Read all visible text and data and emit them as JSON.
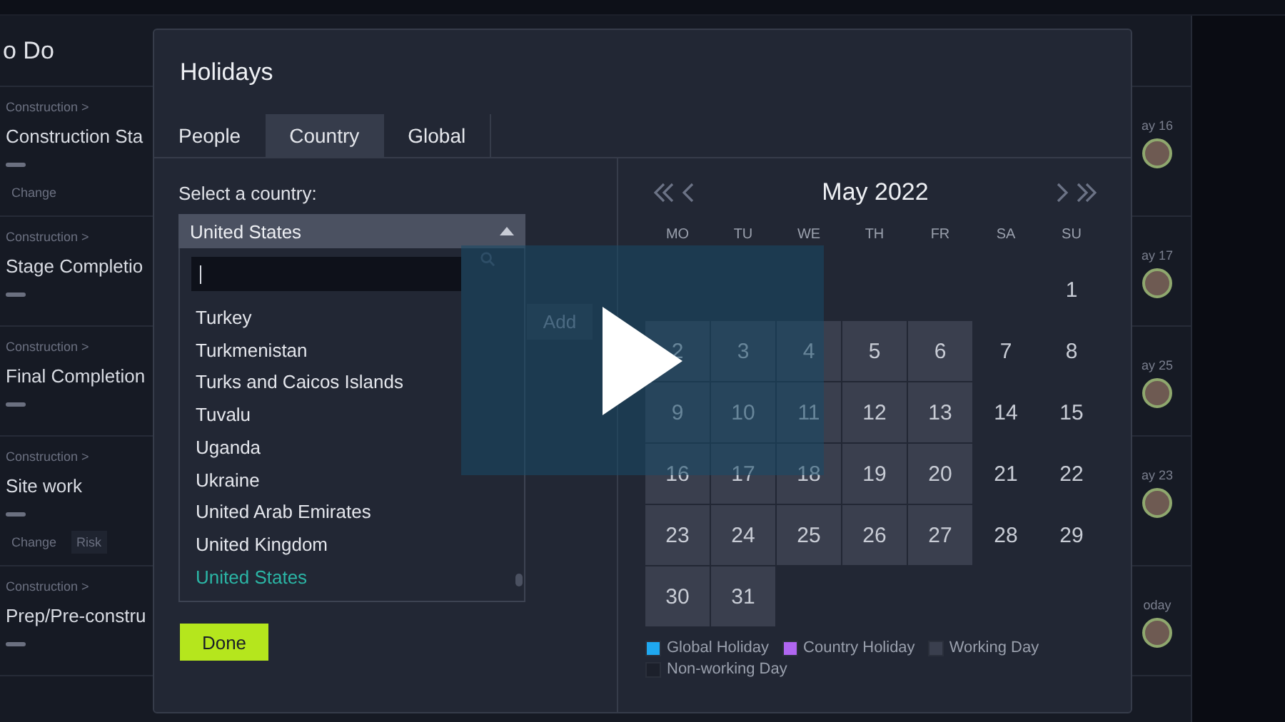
{
  "board": {
    "column_title": "o Do",
    "cards": [
      {
        "breadcrumb": "Construction >",
        "title": "Construction Sta",
        "tags": [
          {
            "label": "Change",
            "filled": false
          }
        ],
        "date": "ay 16"
      },
      {
        "breadcrumb": "Construction >",
        "title": "Stage Completio",
        "date": "ay 17"
      },
      {
        "breadcrumb": "Construction >",
        "title": "Final Completion",
        "date": "ay 25"
      },
      {
        "breadcrumb": "Construction >",
        "title": "Site work",
        "tags": [
          {
            "label": "Change",
            "filled": false
          },
          {
            "label": "Risk",
            "filled": true
          }
        ],
        "date": "ay 23"
      },
      {
        "breadcrumb": "Construction >",
        "title": "Prep/Pre-constru",
        "date": "oday"
      }
    ]
  },
  "dialog": {
    "title": "Holidays",
    "tabs": [
      {
        "label": "People",
        "selected": false
      },
      {
        "label": "Country",
        "selected": true
      },
      {
        "label": "Global",
        "selected": false
      }
    ],
    "country_label": "Select a country:",
    "country_select": {
      "value": "United States",
      "expanded": true
    },
    "countries": [
      {
        "name": "Turkey",
        "selected": false
      },
      {
        "name": "Turkmenistan",
        "selected": false
      },
      {
        "name": "Turks and Caicos Islands",
        "selected": false
      },
      {
        "name": "Tuvalu",
        "selected": false
      },
      {
        "name": "Uganda",
        "selected": false
      },
      {
        "name": "Ukraine",
        "selected": false
      },
      {
        "name": "United Arab Emirates",
        "selected": false
      },
      {
        "name": "United Kingdom",
        "selected": false
      },
      {
        "name": "United States",
        "selected": true
      }
    ],
    "add_button": "Add",
    "done_button": "Done",
    "calendar": {
      "month": "May 2022",
      "weekdays": [
        "MO",
        "TU",
        "WE",
        "TH",
        "FR",
        "SA",
        "SU"
      ],
      "days": [
        {
          "kind": "empty"
        },
        {
          "kind": "empty"
        },
        {
          "kind": "empty"
        },
        {
          "kind": "empty"
        },
        {
          "kind": "empty"
        },
        {
          "kind": "empty"
        },
        {
          "day": "1",
          "kind": "nonworking"
        },
        {
          "day": "2",
          "kind": "working"
        },
        {
          "day": "3",
          "kind": "working"
        },
        {
          "day": "4",
          "kind": "working"
        },
        {
          "day": "5",
          "kind": "working"
        },
        {
          "day": "6",
          "kind": "working"
        },
        {
          "day": "7",
          "kind": "nonworking"
        },
        {
          "day": "8",
          "kind": "nonworking"
        },
        {
          "day": "9",
          "kind": "working"
        },
        {
          "day": "10",
          "kind": "working"
        },
        {
          "day": "11",
          "kind": "working"
        },
        {
          "day": "12",
          "kind": "working"
        },
        {
          "day": "13",
          "kind": "working"
        },
        {
          "day": "14",
          "kind": "nonworking"
        },
        {
          "day": "15",
          "kind": "nonworking"
        },
        {
          "day": "16",
          "kind": "working"
        },
        {
          "day": "17",
          "kind": "working"
        },
        {
          "day": "18",
          "kind": "working"
        },
        {
          "day": "19",
          "kind": "working"
        },
        {
          "day": "20",
          "kind": "working"
        },
        {
          "day": "21",
          "kind": "nonworking"
        },
        {
          "day": "22",
          "kind": "nonworking"
        },
        {
          "day": "23",
          "kind": "working"
        },
        {
          "day": "24",
          "kind": "working"
        },
        {
          "day": "25",
          "kind": "working"
        },
        {
          "day": "26",
          "kind": "working"
        },
        {
          "day": "27",
          "kind": "working"
        },
        {
          "day": "28",
          "kind": "nonworking"
        },
        {
          "day": "29",
          "kind": "nonworking"
        },
        {
          "day": "30",
          "kind": "working"
        },
        {
          "day": "31",
          "kind": "working"
        }
      ],
      "legend": [
        {
          "label": "Global Holiday",
          "color": "#1fa8f0"
        },
        {
          "label": "Country Holiday",
          "color": "#b066f0"
        },
        {
          "label": "Working Day",
          "color": "#3a3f4e"
        },
        {
          "label": "Non-working Day",
          "color": "#1c202b"
        }
      ]
    }
  }
}
